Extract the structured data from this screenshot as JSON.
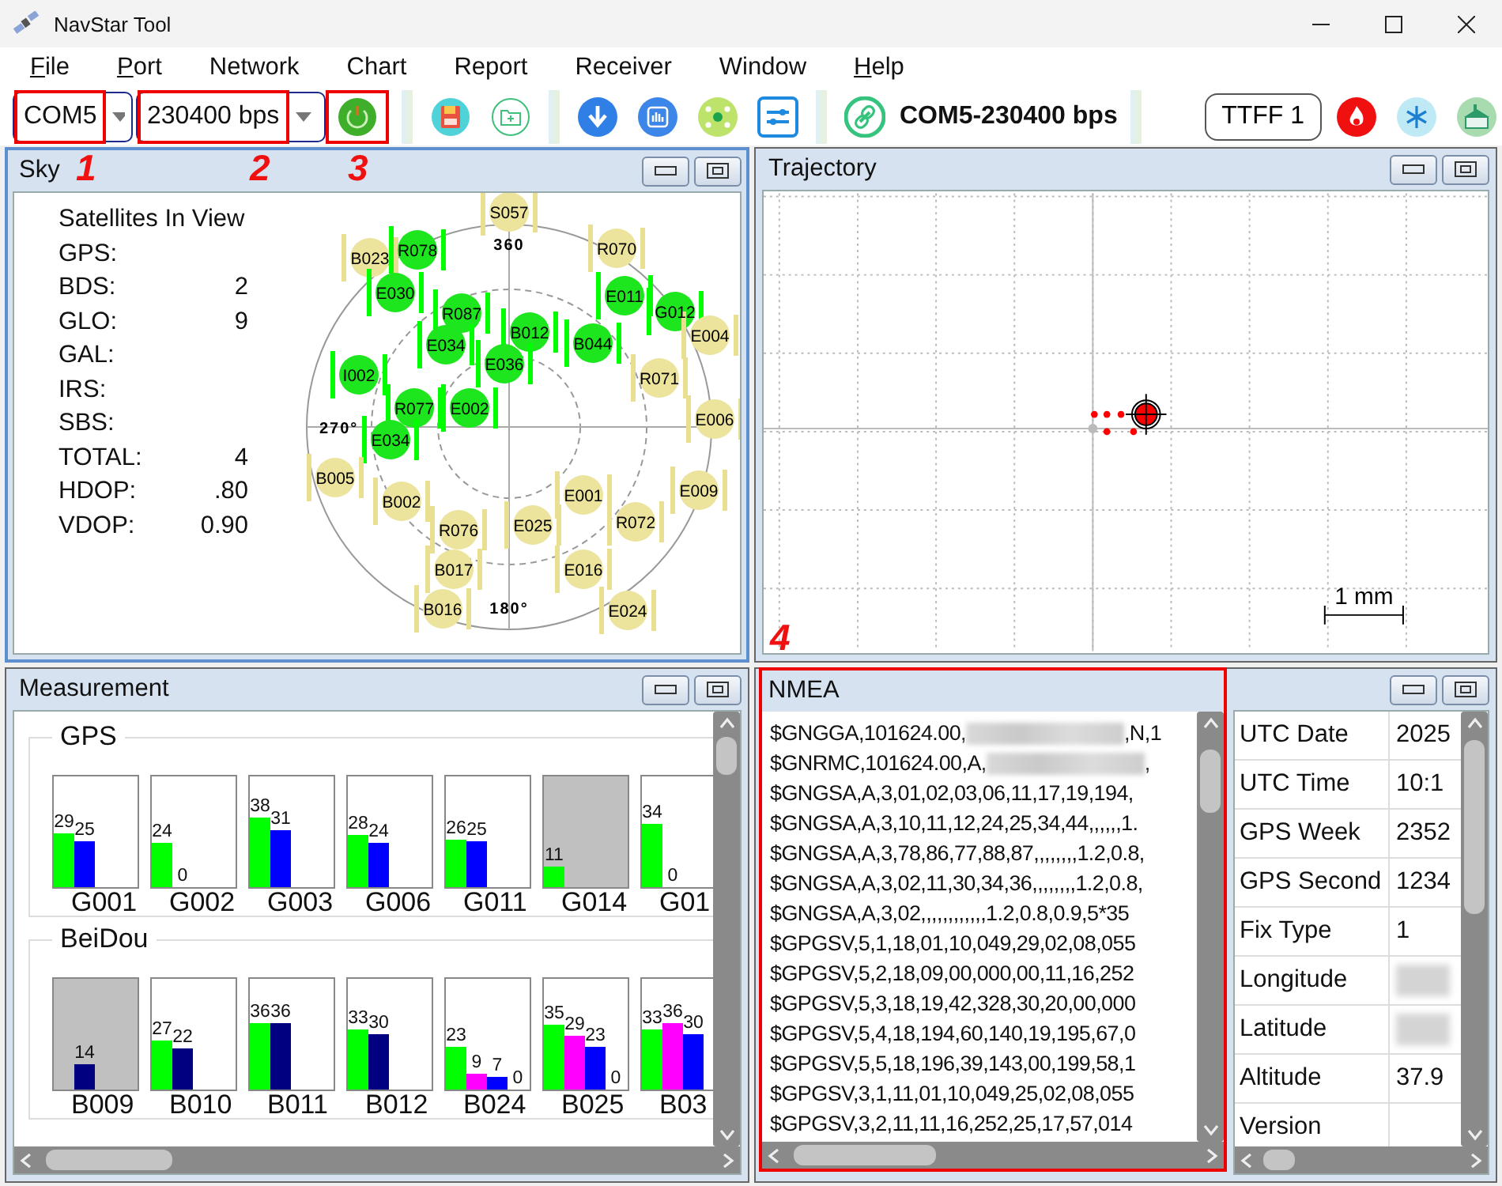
{
  "window": {
    "title": "NavStar Tool"
  },
  "menu": [
    {
      "label": "File",
      "mnemonic": true
    },
    {
      "label": "Port",
      "mnemonic": true
    },
    {
      "label": "Network",
      "mnemonic": false
    },
    {
      "label": "Chart",
      "mnemonic": false
    },
    {
      "label": "Report",
      "mnemonic": false
    },
    {
      "label": "Receiver",
      "mnemonic": false
    },
    {
      "label": "Window",
      "mnemonic": false
    },
    {
      "label": "Help",
      "mnemonic": true
    }
  ],
  "toolbar": {
    "port": {
      "value": "COM5",
      "highlighted": true
    },
    "baud": {
      "value": "230400 bps",
      "highlighted": true
    },
    "power": {
      "highlighted": true
    },
    "connection": "COM5-230400 bps",
    "ttff": "TTFF 1"
  },
  "sky": {
    "title": "Sky",
    "active": true,
    "callouts": [
      "1",
      "2",
      "3"
    ],
    "heading": "Satellites In View",
    "stats": [
      {
        "label": "GPS:"
      },
      {
        "label": "BDS:",
        "value": "2"
      },
      {
        "label": "GLO:",
        "value": "9"
      },
      {
        "label": "GAL:"
      },
      {
        "label": "IRS:"
      },
      {
        "label": "SBS:"
      },
      {
        "label": "TOTAL:",
        "value": "4"
      },
      {
        "label": "HDOP:",
        "value": ".80"
      },
      {
        "label": "VDOP:",
        "value": "0.90"
      }
    ],
    "compass": [
      "360",
      "270°",
      "180°"
    ],
    "satellites": [
      {
        "label": "S057",
        "used": false
      },
      {
        "label": "R070",
        "used": false
      },
      {
        "label": "B023",
        "used": false
      },
      {
        "label": "R078",
        "used": true
      },
      {
        "label": "E030",
        "used": true
      },
      {
        "label": "R087",
        "used": true
      },
      {
        "label": "E034",
        "used": true
      },
      {
        "label": "B012",
        "used": true
      },
      {
        "label": "E036",
        "used": true
      },
      {
        "label": "B044",
        "used": true
      },
      {
        "label": "E011",
        "used": true
      },
      {
        "label": "G012",
        "used": true
      },
      {
        "label": "E004",
        "used": false
      },
      {
        "label": "R071",
        "used": false
      },
      {
        "label": "I002",
        "used": true
      },
      {
        "label": "R077",
        "used": true
      },
      {
        "label": "E002",
        "used": true
      },
      {
        "label": "E034",
        "used": true
      },
      {
        "label": "E006",
        "used": false
      },
      {
        "label": "B005",
        "used": false
      },
      {
        "label": "B002",
        "used": false
      },
      {
        "label": "R076",
        "used": false
      },
      {
        "label": "E001",
        "used": false
      },
      {
        "label": "R072",
        "used": false
      },
      {
        "label": "E009",
        "used": false
      },
      {
        "label": "E025",
        "used": false
      },
      {
        "label": "B017",
        "used": false
      },
      {
        "label": "E016",
        "used": false
      },
      {
        "label": "B016",
        "used": false
      },
      {
        "label": "E024",
        "used": false
      }
    ]
  },
  "trajectory": {
    "title": "Trajectory",
    "active": false,
    "callout": "4",
    "scale": "1 mm"
  },
  "measurement": {
    "title": "Measurement",
    "active": false,
    "groups": [
      {
        "name": "GPS",
        "satellites": [
          {
            "name": "G001",
            "used": true,
            "bars": [
              {
                "value": "29",
                "color": "#00ff00",
                "level": 0.48
              },
              {
                "value": "25",
                "color": "#0000ff",
                "level": 0.42
              }
            ]
          },
          {
            "name": "G002",
            "used": true,
            "bars": [
              {
                "value": "24",
                "color": "#00ff00",
                "level": 0.4
              },
              {
                "value": "0"
              }
            ]
          },
          {
            "name": "G003",
            "used": true,
            "bars": [
              {
                "value": "38",
                "color": "#00ff00",
                "level": 0.63
              },
              {
                "value": "31",
                "color": "#0000ff",
                "level": 0.52
              }
            ]
          },
          {
            "name": "G006",
            "used": true,
            "bars": [
              {
                "value": "28",
                "color": "#00ff00",
                "level": 0.47
              },
              {
                "value": "24",
                "color": "#0000ff",
                "level": 0.4
              }
            ]
          },
          {
            "name": "G011",
            "used": true,
            "bars": [
              {
                "value": "26",
                "color": "#00ff00",
                "level": 0.43
              },
              {
                "value": "25",
                "color": "#0000ff",
                "level": 0.42
              }
            ]
          },
          {
            "name": "G014",
            "used": false,
            "bars": [
              {
                "value": "11",
                "color": "#00ff00",
                "level": 0.18
              }
            ]
          },
          {
            "name": "G01",
            "used": true,
            "bars": [
              {
                "value": "34",
                "color": "#00ff00",
                "level": 0.57
              },
              {
                "value": "0"
              }
            ]
          }
        ]
      },
      {
        "name": "BeiDou",
        "satellites": [
          {
            "name": "B009",
            "used": false,
            "bars": [
              {
                "kind": "gap"
              },
              {
                "kind": "bar",
                "value": "14",
                "color": "#000080",
                "level": 0.23
              }
            ]
          },
          {
            "name": "B010",
            "used": true,
            "bars": [
              {
                "value": "27",
                "color": "#00ff00",
                "level": 0.45
              },
              {
                "value": "22",
                "color": "#000080",
                "level": 0.37
              }
            ]
          },
          {
            "name": "B011",
            "used": true,
            "bars": [
              {
                "value": "36",
                "color": "#00ff00",
                "level": 0.6
              },
              {
                "value": "36",
                "color": "#000080",
                "level": 0.6
              }
            ]
          },
          {
            "name": "B012",
            "used": true,
            "bars": [
              {
                "value": "33",
                "color": "#00ff00",
                "level": 0.55
              },
              {
                "value": "30",
                "color": "#000080",
                "level": 0.5
              }
            ]
          },
          {
            "name": "B024",
            "used": true,
            "bars": [
              {
                "value": "23",
                "color": "#00ff00",
                "level": 0.38
              },
              {
                "value": "9",
                "color": "#ff00ff",
                "level": 0.15
              },
              {
                "value": "7",
                "color": "#0000ff",
                "level": 0.12
              },
              {
                "value": "0"
              }
            ]
          },
          {
            "name": "B025",
            "used": true,
            "bars": [
              {
                "value": "35",
                "color": "#00ff00",
                "level": 0.58
              },
              {
                "value": "29",
                "color": "#ff00ff",
                "level": 0.48
              },
              {
                "value": "23",
                "color": "#0000ff",
                "level": 0.38
              },
              {
                "value": "0"
              }
            ]
          },
          {
            "name": "B03",
            "used": true,
            "bars": [
              {
                "value": "33",
                "color": "#00ff00",
                "level": 0.55
              },
              {
                "value": "36",
                "color": "#ff00ff",
                "level": 0.6
              },
              {
                "value": "30",
                "color": "#0000ff",
                "level": 0.5
              }
            ]
          }
        ]
      }
    ]
  },
  "nmea": {
    "title": "NMEA",
    "highlighted": true,
    "lines": [
      {
        "text": "$GNGGA,101624.00,",
        "redacted": true,
        "tail": ",N,1"
      },
      {
        "text": "$GNRMC,101624.00,A,",
        "redacted": true,
        "tail": ","
      },
      {
        "text": "$GNGSA,A,3,01,02,03,06,11,17,19,194,",
        "redacted": false
      },
      {
        "text": "$GNGSA,A,3,10,11,12,24,25,34,44,,,,,,1.",
        "redacted": false
      },
      {
        "text": "$GNGSA,A,3,78,86,77,88,87,,,,,,,,1.2,0.8,",
        "redacted": false
      },
      {
        "text": "$GNGSA,A,3,02,11,30,34,36,,,,,,,,1.2,0.8,",
        "redacted": false
      },
      {
        "text": "$GNGSA,A,3,02,,,,,,,,,,,,1.2,0.8,0.9,5*35",
        "redacted": false
      },
      {
        "text": "$GPGSV,5,1,18,01,10,049,29,02,08,055",
        "redacted": false
      },
      {
        "text": "$GPGSV,5,2,18,09,00,000,00,11,16,252",
        "redacted": false
      },
      {
        "text": "$GPGSV,5,3,18,19,42,328,30,20,00,000",
        "redacted": false
      },
      {
        "text": "$GPGSV,5,4,18,194,60,140,19,195,67,0",
        "redacted": false
      },
      {
        "text": "$GPGSV,5,5,18,196,39,143,00,199,58,1",
        "redacted": false
      },
      {
        "text": "$GPGSV,3,1,11,01,10,049,25,02,08,055",
        "redacted": false
      },
      {
        "text": "$GPGSV,3,2,11,11,16,252,25,17,57,014",
        "redacted": false
      }
    ]
  },
  "info": {
    "rows": [
      {
        "label": "UTC Date",
        "value": "2025"
      },
      {
        "label": "UTC Time",
        "value": "10:1"
      },
      {
        "label": "GPS Week",
        "value": "2352"
      },
      {
        "label": "GPS Second",
        "value": "1234"
      },
      {
        "label": "Fix Type",
        "value": "1"
      },
      {
        "label": "Longitude",
        "redacted": true
      },
      {
        "label": "Latitude",
        "redacted": true
      },
      {
        "label": "Altitude",
        "value": "37.9"
      },
      {
        "label": "Version"
      }
    ]
  }
}
